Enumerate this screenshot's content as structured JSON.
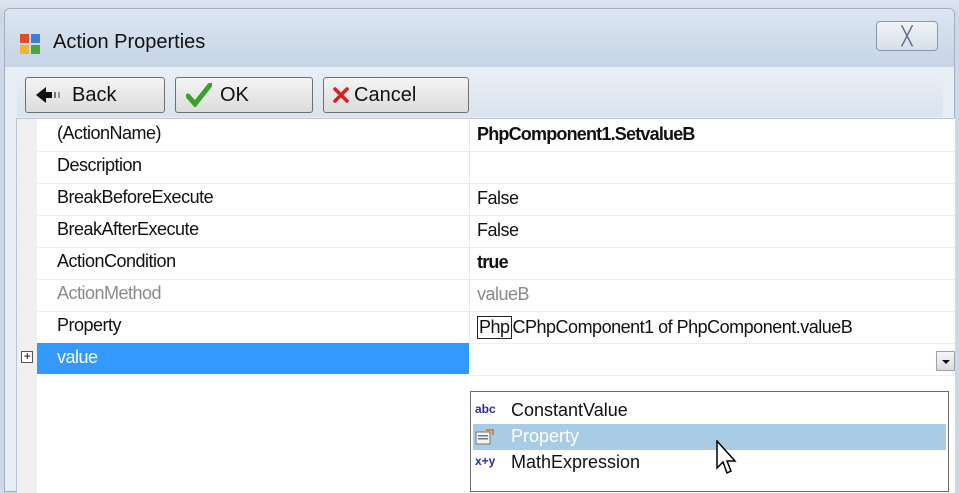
{
  "window": {
    "title": "Action Properties",
    "close_label": "╳"
  },
  "toolbar": {
    "back_label": "Back",
    "ok_label": "OK",
    "cancel_label": "Cancel"
  },
  "properties": [
    {
      "name": "(ActionName)",
      "value": "PhpComponent1.SetvalueB",
      "bold": true,
      "dim": false
    },
    {
      "name": "Description",
      "value": "",
      "bold": false,
      "dim": false
    },
    {
      "name": "BreakBeforeExecute",
      "value": "False",
      "bold": false,
      "dim": false
    },
    {
      "name": "BreakAfterExecute",
      "value": "False",
      "bold": false,
      "dim": false
    },
    {
      "name": "ActionCondition",
      "value": "true",
      "bold": true,
      "dim": false
    },
    {
      "name": "ActionMethod",
      "value": "valueB",
      "bold": false,
      "dim": true
    },
    {
      "name": "Property",
      "value_prefix": "Php",
      "value": "CPhpComponent1 of PhpComponent.valueB",
      "bold": false,
      "dim": false
    }
  ],
  "selected_row": {
    "name": "value",
    "expander": "+"
  },
  "dropdown": {
    "options": [
      {
        "icon": "abc",
        "label": "ConstantValue",
        "highlighted": false
      },
      {
        "icon": "property-icon",
        "label": "Property",
        "highlighted": true
      },
      {
        "icon": "x+y",
        "label": "MathExpression",
        "highlighted": false
      }
    ]
  },
  "colors": {
    "selection": "#3399ff",
    "highlight": "#a8cbe6",
    "check_green": "#3aa12a",
    "cancel_red": "#d42020"
  }
}
